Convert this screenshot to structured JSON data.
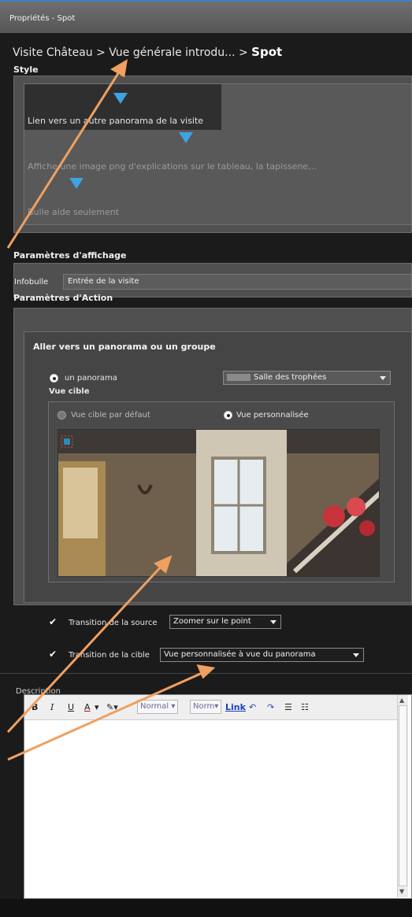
{
  "window": {
    "title": "Propriétés - Spot"
  },
  "breadcrumb": {
    "path": "Visite Château > Vue générale introdu... >",
    "current": "Spot"
  },
  "style": {
    "title": "Style",
    "items": [
      {
        "label": "Lien vers un autre panorama de la visite",
        "selected": true
      },
      {
        "label": "Affiche une image png d'explications sur le tableau, la tapissene,..",
        "selected": false
      },
      {
        "label": "Bulle aide seulement",
        "selected": false
      }
    ]
  },
  "affichage": {
    "title": "Paramètres d'affichage",
    "infobulle_label": "Infobulle",
    "infobulle_value": "Entrée de la visite"
  },
  "action": {
    "title": "Paramètres d'Action",
    "aller_title": "Aller vers un panorama ou un groupe",
    "panorama_radio": "un panorama",
    "panorama_select": "Salle des trophées",
    "vue_cible_title": "Vue cible",
    "vue_defaut": "Vue cible par défaut",
    "vue_perso": "Vue personnalisée",
    "transition_source_label": "Transition de la source",
    "transition_source_value": "Zoomer sur le point",
    "transition_cible_label": "Transition de la cible",
    "transition_cible_value": "Vue personnalisée à vue du panorama"
  },
  "description": {
    "title": "Description",
    "toolbar": {
      "bold": "B",
      "italic": "I",
      "underline": "U",
      "font_color": "A",
      "style": "Normal",
      "size": "Norm",
      "link": "Link"
    }
  },
  "colors": {
    "accent": "#3fa2e3",
    "panel": "#505050"
  }
}
